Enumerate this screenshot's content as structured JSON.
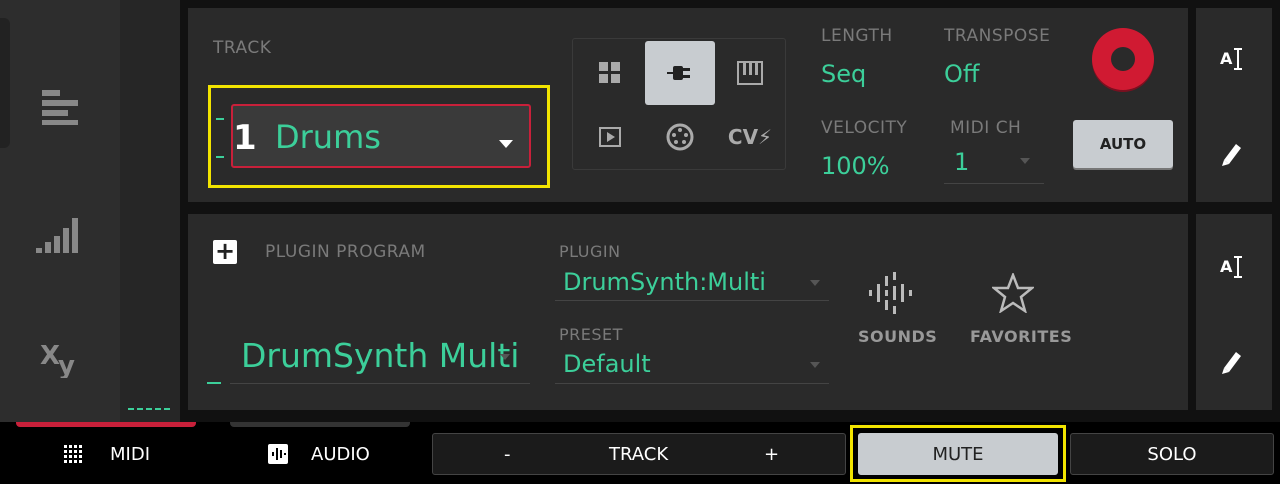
{
  "track_section": {
    "label": "TRACK",
    "number": "1",
    "name": "Drums"
  },
  "track_types": [
    "grid-icon",
    "plug-icon",
    "keys-icon",
    "play-icon",
    "midi-din-icon",
    "cv-icon"
  ],
  "track_types_cv_label": "CV⚡",
  "params": {
    "length_label": "LENGTH",
    "length_value": "Seq",
    "transpose_label": "TRANSPOSE",
    "transpose_value": "Off",
    "velocity_label": "VELOCITY",
    "velocity_value": "100%",
    "midi_ch_label": "MIDI CH",
    "midi_ch_value": "1"
  },
  "auto_label": "AUTO",
  "plugin_section": {
    "program_label": "PLUGIN PROGRAM",
    "program_name": "DrumSynth Multi",
    "plugin_label": "PLUGIN",
    "plugin_value": "DrumSynth:Multi",
    "preset_label": "PRESET",
    "preset_value": "Default",
    "sounds_label": "SOUNDS",
    "favorites_label": "FAVORITES"
  },
  "bottom_bar": {
    "midi_label": "MIDI",
    "audio_label": "AUDIO",
    "track_minus": "-",
    "track_label": "TRACK",
    "track_plus": "+",
    "mute_label": "MUTE",
    "solo_label": "SOLO"
  },
  "colors": {
    "accent_green": "#3ccf9a",
    "record_red": "#d01a32",
    "highlight_yellow": "#f2e400",
    "panel_bg": "#2a2a2a"
  }
}
